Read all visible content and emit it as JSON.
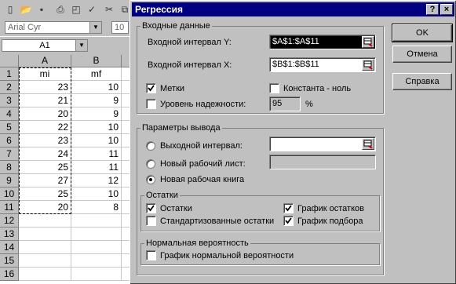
{
  "excel": {
    "font_name": "Arial Cyr",
    "font_size": "10",
    "name_box": "A1",
    "columns": [
      "A",
      "B"
    ],
    "rows": [
      {
        "n": "1",
        "a": "mi",
        "b": "mf"
      },
      {
        "n": "2",
        "a": "23",
        "b": "10"
      },
      {
        "n": "3",
        "a": "21",
        "b": "9"
      },
      {
        "n": "4",
        "a": "20",
        "b": "9"
      },
      {
        "n": "5",
        "a": "22",
        "b": "10"
      },
      {
        "n": "6",
        "a": "23",
        "b": "10"
      },
      {
        "n": "7",
        "a": "24",
        "b": "11"
      },
      {
        "n": "8",
        "a": "25",
        "b": "11"
      },
      {
        "n": "9",
        "a": "27",
        "b": "12"
      },
      {
        "n": "10",
        "a": "25",
        "b": "10"
      },
      {
        "n": "11",
        "a": "20",
        "b": "8"
      },
      {
        "n": "12",
        "a": "",
        "b": ""
      },
      {
        "n": "13",
        "a": "",
        "b": ""
      },
      {
        "n": "14",
        "a": "",
        "b": ""
      },
      {
        "n": "15",
        "a": "",
        "b": ""
      },
      {
        "n": "16",
        "a": "",
        "b": ""
      }
    ]
  },
  "dialog": {
    "title": "Регрессия",
    "help_btn": "?",
    "close_btn": "×",
    "input_group": "Входные данные",
    "input_y_label": "Входной интервал Y:",
    "input_y_value": "$A$1:$A$11",
    "input_x_label": "Входной интервал X:",
    "input_x_value": "$B$1:$B$11",
    "labels": "Метки",
    "const_zero": "Константа - ноль",
    "confidence": "Уровень надежности:",
    "confidence_value": "95",
    "percent": "%",
    "output_group": "Параметры вывода",
    "output_range": "Выходной интервал:",
    "new_sheet": "Новый рабочий лист:",
    "new_book": "Новая рабочая книга",
    "residuals_group": "Остатки",
    "residuals": "Остатки",
    "std_residuals": "Стандартизованные остатки",
    "residual_plots": "График остатков",
    "line_fit_plots": "График подбора",
    "normal_group": "Нормальная вероятность",
    "normal_plot": "График нормальной вероятности",
    "ok": "OK",
    "cancel": "Отмена",
    "help": "Справка"
  }
}
